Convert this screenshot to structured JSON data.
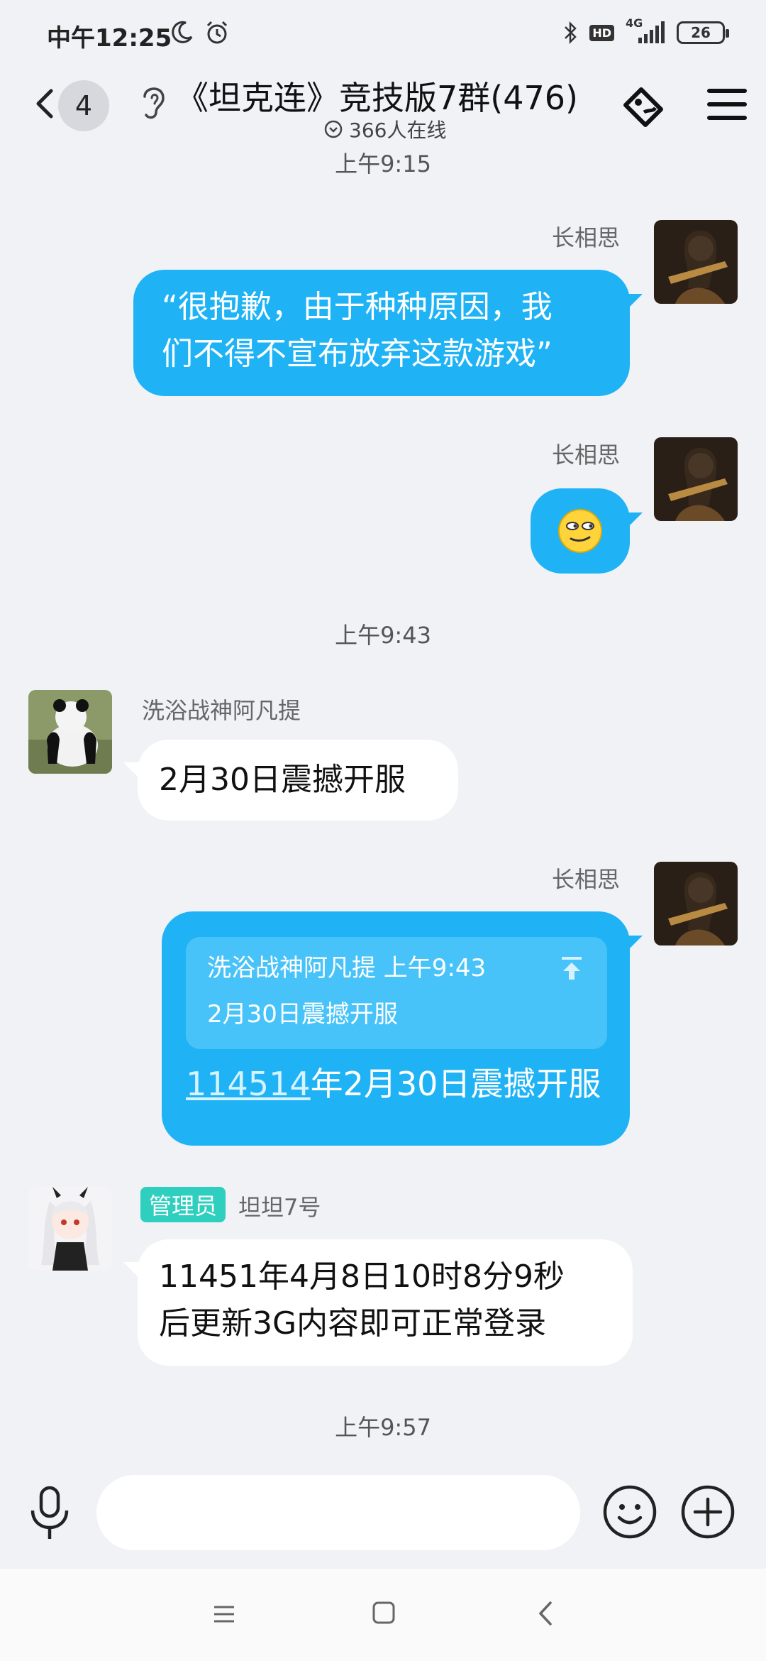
{
  "status": {
    "time": "中午12:25",
    "network": "4G",
    "hd": "HD",
    "battery": "26"
  },
  "header": {
    "unread_count": "4",
    "title": "《坦克连》竞技版7群(476)",
    "online": "366人在线"
  },
  "messages": {
    "ts_top": "上午9:15",
    "m1": {
      "sender": "长相思",
      "line1": "“很抱歉，由于种种原因，我",
      "line2": "们不得不宣布放弃这款游戏”"
    },
    "m2": {
      "sender": "长相思"
    },
    "ts_943": "上午9:43",
    "m3": {
      "sender": "洗浴战神阿凡提",
      "text": "2月30日震撼开服"
    },
    "m4": {
      "sender": "长相思",
      "quote_sender": "洗浴战神阿凡提 上午9:43",
      "quote_text": "2月30日震撼开服",
      "link_number": "114514",
      "text_rest": "年2月30日震撼开服"
    },
    "m5": {
      "role": "管理员",
      "sender": "坦坦7号",
      "line1": "11451年4月8日10时8分9秒",
      "line2": "后更新3G内容即可正常登录"
    },
    "ts_957": "上午9:57"
  },
  "input": {
    "placeholder": ""
  },
  "colors": {
    "bubble_out": "#1fb3f6",
    "bubble_in": "#ffffff",
    "background": "#f1f2f6",
    "admin_tag": "#2fcfc0"
  },
  "icons": {
    "back": "chevron-left-icon",
    "ear": "ear-icon",
    "tag": "tag-icon",
    "menu": "menu-icon",
    "mic": "mic-icon",
    "emoji": "smile-icon",
    "plus": "plus-icon"
  }
}
